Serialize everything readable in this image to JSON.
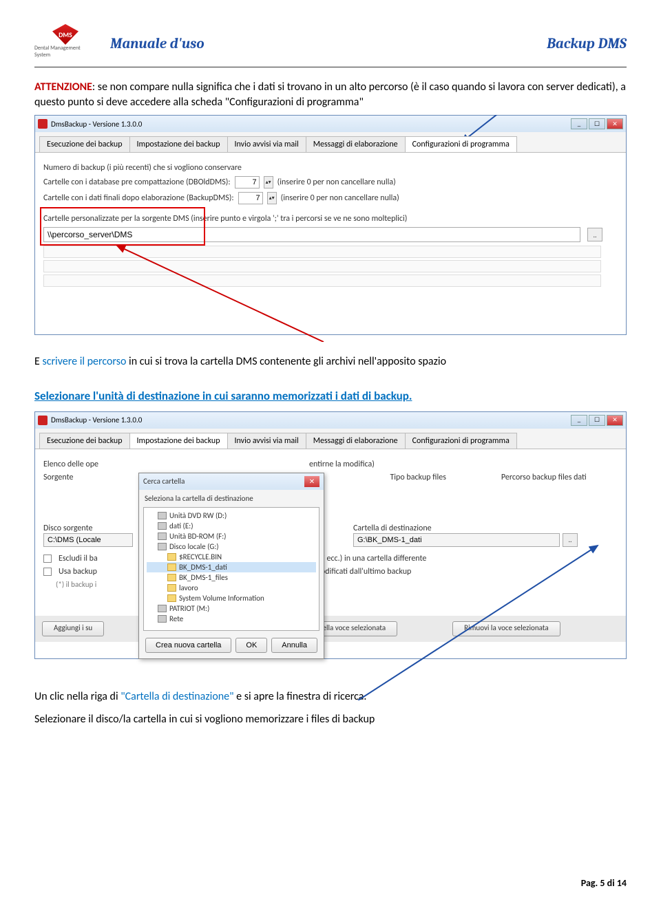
{
  "header": {
    "logo_text": "DMS",
    "logo_subtitle": "Dental Management System",
    "title_left": "Manuale d'uso",
    "title_right": "Backup DMS"
  },
  "para1": {
    "attenzione": "ATTENZIONE",
    "rest1": ": se non compare nulla significa che i dati si trovano in un alto percorso (è il caso quando si lavora con server dedicati), a questo punto si deve accedere alla scheda ",
    "quoted": "\"Configurazioni di programma\""
  },
  "shot1": {
    "window_title": "DmsBackup - Versione 1.3.0.0",
    "tabs": [
      "Esecuzione dei backup",
      "Impostazione dei backup",
      "Invio avvisi via mail",
      "Messaggi di elaborazione",
      "Configurazioni di programma"
    ],
    "line1": "Numero di backup (i più recenti) che si vogliono conservare",
    "line2_label": "Cartelle con i database pre compattazione (DBOldDMS):",
    "line2_value": "7",
    "line2_hint": "(inserire 0 per non cancellare nulla)",
    "line3_label": "Cartelle con i dati finali dopo elaborazione (BackupDMS):",
    "line3_value": "7",
    "line3_hint": "(inserire 0 per non cancellare nulla)",
    "long_label": "Cartelle personalizzate per la sorgente DMS (inserire punto e virgola ';' tra i percorsi se ve ne sono molteplici)",
    "path_value": "\\\\percorso_server\\DMS",
    "browse": ".."
  },
  "para2": {
    "pretext": "E ",
    "scrivere": "scrivere il percorso",
    "rest": " in cui si trova la cartella DMS contenente gli archivi nell'apposito spazio"
  },
  "para3": "Selezionare l'unità di destinazione in cui saranno memorizzati i dati di backup.",
  "shot2": {
    "window_title": "DmsBackup - Versione 1.3.0.0",
    "tabs": [
      "Esecuzione dei backup",
      "Impostazione dei backup",
      "Invio avvisi via mail",
      "Messaggi di elaborazione",
      "Configurazioni di programma"
    ],
    "elenco": "Elenco delle ope",
    "elenco_tail": "entirne la modifica)",
    "sorgente_label": "Sorgente",
    "tipo_label": "Tipo backup files",
    "percorso_label": "Percorso backup files dati",
    "disco_sorgente_label": "Disco sorgente",
    "disco_sorgente_val": "C:\\DMS (Locale",
    "cartella_dest_label": "Cartella di destinazione",
    "cartella_dest_val": "G:\\BK_DMS-1_dati",
    "browse": "..",
    "chk1": "Escludi il ba",
    "chk2": "Usa backup",
    "chk2_sub": "(*) il backup i",
    "mid1": "moduli ecc.) in una cartella differente",
    "mid2": "e/o modificati dall'ultimo backup",
    "btn_aggiungi": "Aggiungi i su",
    "btn_modifica": "odifica i valori della voce selezionata",
    "btn_rimuovi": "Rimuovi la voce selezionata",
    "dialog": {
      "title": "Cerca cartella",
      "subtitle": "Seleziona la cartella di destinazione",
      "items": [
        {
          "label": "Unità DVD RW (D:)",
          "type": "drive",
          "level": 1
        },
        {
          "label": "dati (E:)",
          "type": "drive",
          "level": 1
        },
        {
          "label": "Unità BD-ROM (F:)",
          "type": "drive",
          "level": 1
        },
        {
          "label": "Disco locale (G:)",
          "type": "drive",
          "level": 1,
          "expanded": true
        },
        {
          "label": "$RECYCLE.BIN",
          "type": "folder",
          "level": 2
        },
        {
          "label": "BK_DMS-1_dati",
          "type": "folder",
          "level": 2,
          "selected": true
        },
        {
          "label": "BK_DMS-1_files",
          "type": "folder",
          "level": 2
        },
        {
          "label": "lavoro",
          "type": "folder",
          "level": 2
        },
        {
          "label": "System Volume Information",
          "type": "folder",
          "level": 2
        },
        {
          "label": "PATRIOT (M:)",
          "type": "drive",
          "level": 1
        },
        {
          "label": "Rete",
          "type": "net",
          "level": 1
        }
      ],
      "btn_new": "Crea nuova cartella",
      "btn_ok": "OK",
      "btn_cancel": "Annulla"
    }
  },
  "para4": {
    "pre": "Un clic nella riga di ",
    "quoted": "\"Cartella di destinazione\"",
    "post": " e si apre la finestra di ricerca."
  },
  "para5": "Selezionare il disco/la cartella in cui si vogliono memorizzare i files di backup",
  "footer": {
    "pre": "Pag. ",
    "num": "5",
    "mid": " di ",
    "tot": "14"
  }
}
